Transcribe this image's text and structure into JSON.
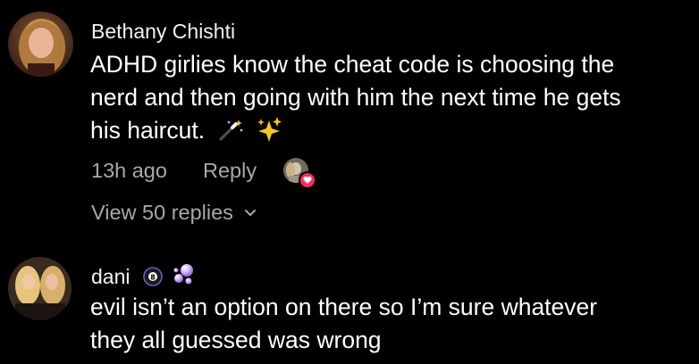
{
  "comments": [
    {
      "username": "Bethany Chishti",
      "text_lines": [
        "ADHD girlies know the cheat code is choosing the",
        "nerd and then going with him the next time he gets",
        "his haircut."
      ],
      "emojis": [
        "magic-wand-emoji",
        "sparkles-emoji"
      ],
      "timestamp": "13h ago",
      "reply_label": "Reply",
      "liked_by_creator": true,
      "view_replies_label": "View 50 replies"
    },
    {
      "username": "dani",
      "badges": [
        "eight-ball-badge",
        "bubbles-badge"
      ],
      "text_lines": [
        "evil isn’t an option on there so I’m sure whatever",
        "they all guessed was wrong"
      ]
    }
  ],
  "colors": {
    "background": "#000000",
    "text": "#ffffff",
    "meta": "#a8a8a8",
    "heart_badge": "#fe2c55"
  }
}
